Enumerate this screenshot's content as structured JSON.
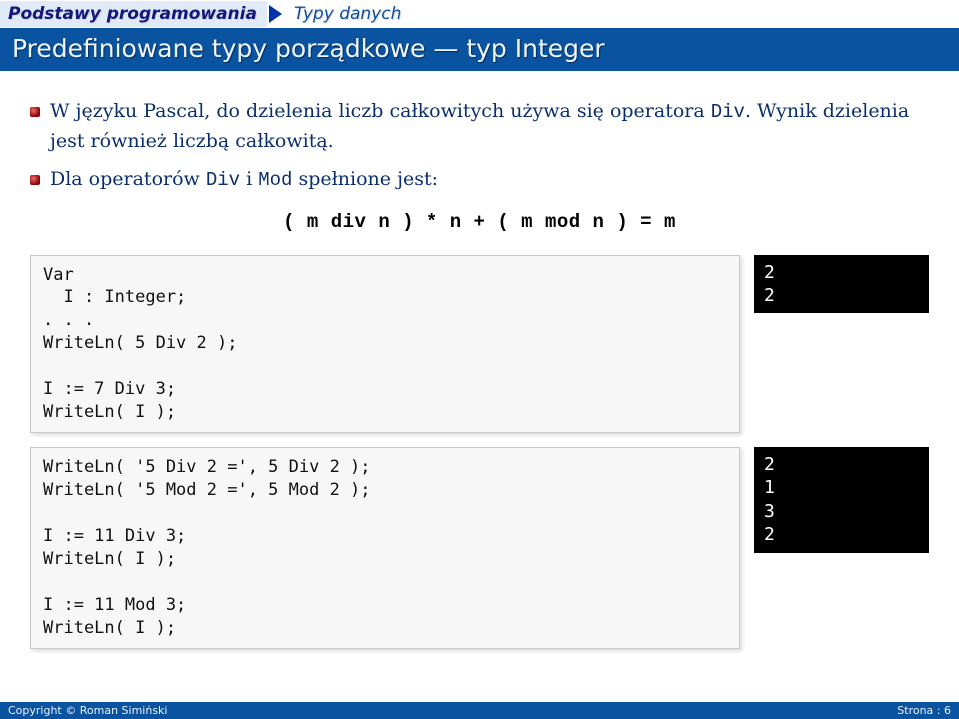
{
  "breadcrumb": {
    "item1": "Podstawy programowania",
    "item2": "Typy danych"
  },
  "title": "Predefiniowane typy porządkowe — typ Integer",
  "paragraphs": {
    "p1_pre": "W języku Pascal, do dzielenia liczb całkowitych używa się operatora ",
    "p1_code": "Div",
    "p1_post": ". Wynik dzielenia jest również liczbą całkowitą.",
    "p2_pre": "Dla operatorów ",
    "p2_c1": "Div",
    "p2_mid": " i ",
    "p2_c2": "Mod",
    "p2_post": " spełnione jest:"
  },
  "identity": "( m div n ) * n + ( m mod n ) = m",
  "code": {
    "block1": "Var\n  I : Integer;\n. . .\nWriteLn( 5 Div 2 );\n\nI := 7 Div 3;\nWriteLn( I );",
    "console1": "2\n2",
    "block2": "WriteLn( '5 Div 2 =', 5 Div 2 );\nWriteLn( '5 Mod 2 =', 5 Mod 2 );\n\nI := 11 Div 3;\nWriteLn( I );\n\nI := 11 Mod 3;\nWriteLn( I );",
    "console2": "2\n1\n3\n2"
  },
  "footer": {
    "left": "Copyright © Roman Simiński",
    "right": "Strona : 6"
  }
}
